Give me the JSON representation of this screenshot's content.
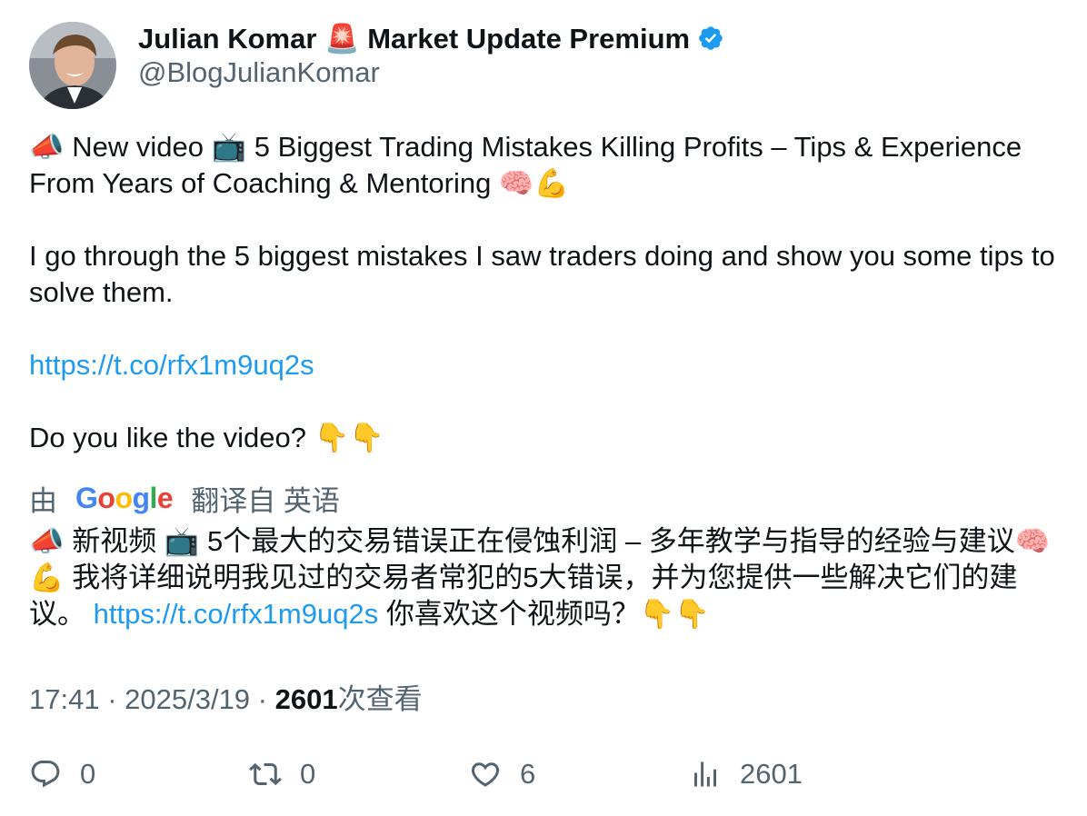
{
  "author": {
    "name": "Julian Komar 🚨 Market Update Premium",
    "handle": "@BlogJulianKomar"
  },
  "tweet": {
    "line1": "📣 New video 📺 5 Biggest Trading Mistakes Killing Profits – Tips & Experience From Years of Coaching & Mentoring 🧠💪",
    "line2": "I go through the 5 biggest mistakes I saw traders doing and show you some tips to solve them.",
    "link": "https://t.co/rfx1m9uq2s",
    "line3": "Do you like the video? 👇👇"
  },
  "translation": {
    "prefix": "由",
    "google_letters": [
      "G",
      "o",
      "o",
      "g",
      "l",
      "e"
    ],
    "suffix": "翻译自 英语",
    "text_part1": "📣 新视频 📺 5个最大的交易错误正在侵蚀利润 – 多年教学与指导的经验与建议🧠💪 我将详细说明我见过的交易者常犯的5大错误，并为您提供一些解决它们的建议。 ",
    "link": "https://t.co/rfx1m9uq2s",
    "text_part2": " 你喜欢这个视频吗？👇👇"
  },
  "meta": {
    "time": "17:41",
    "sep1": " · ",
    "date": "2025/3/19",
    "sep2": " · ",
    "views": "2601",
    "views_label": "次查看"
  },
  "actions": {
    "replies": "0",
    "reposts": "0",
    "likes": "6",
    "views": "2601"
  },
  "colors": {
    "link": "#1d9bf0",
    "secondary_text": "#536471",
    "verified": "#1d9bf0"
  },
  "icons": [
    "verified-badge-icon",
    "reply-icon",
    "repost-icon",
    "like-icon",
    "views-icon"
  ]
}
